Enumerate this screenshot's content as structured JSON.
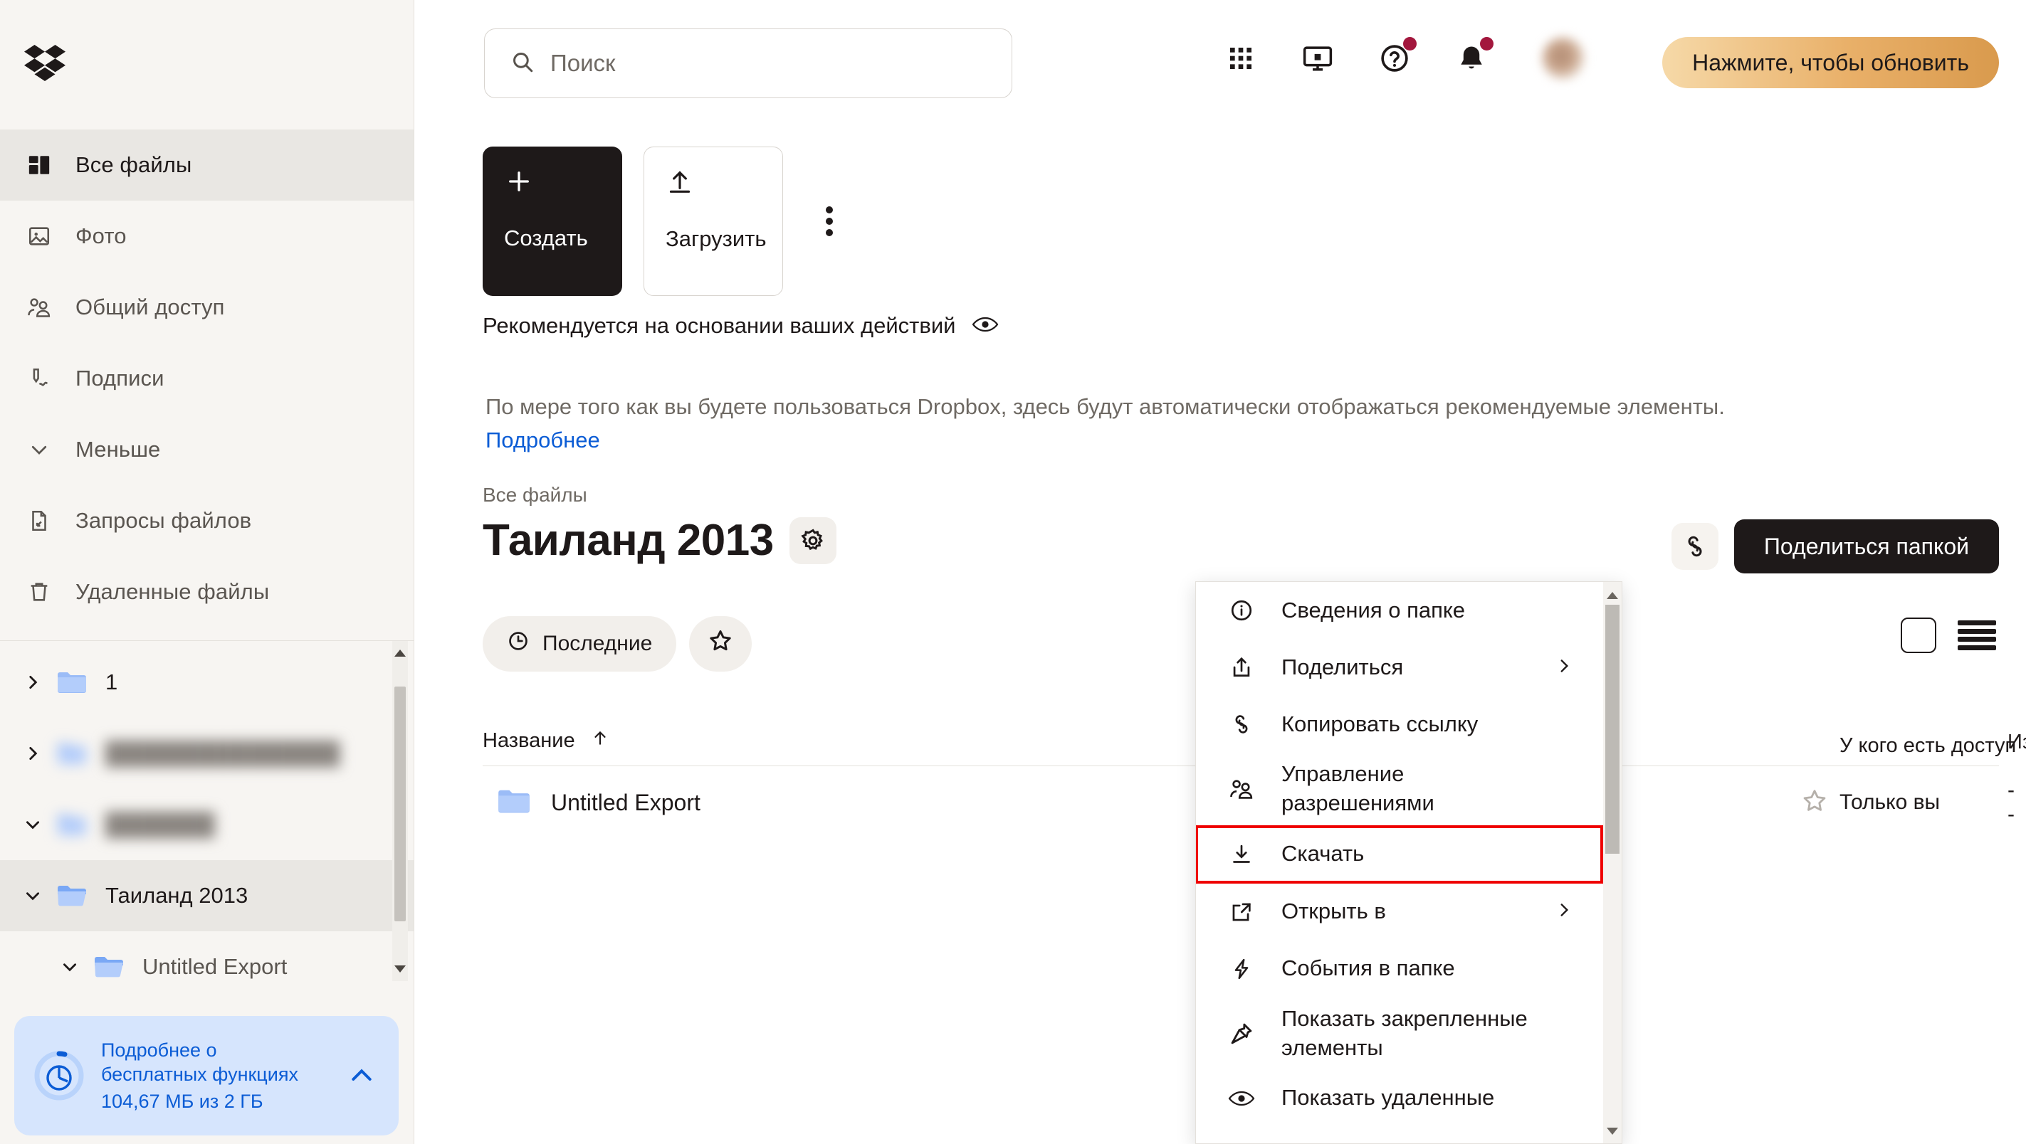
{
  "brand": {
    "name": "Dropbox",
    "logo_icon": "dropbox-logo"
  },
  "sidebar": {
    "nav": [
      {
        "label": "Все файлы",
        "icon": "all-files-icon",
        "active": true
      },
      {
        "label": "Фото",
        "icon": "photo-icon",
        "active": false
      },
      {
        "label": "Общий доступ",
        "icon": "shared-users-icon",
        "active": false
      },
      {
        "label": "Подписи",
        "icon": "signature-icon",
        "active": false
      },
      {
        "label": "Меньше",
        "icon": "chevron-down-icon",
        "active": false
      },
      {
        "label": "Запросы файлов",
        "icon": "file-request-icon",
        "active": false
      },
      {
        "label": "Удаленные файлы",
        "icon": "trash-icon",
        "active": false
      }
    ],
    "tree": [
      {
        "label": "1",
        "expanded": false,
        "blurred": false,
        "level": 1,
        "selected": false
      },
      {
        "label": "",
        "expanded": false,
        "blurred": true,
        "level": 1,
        "selected": false
      },
      {
        "label": "",
        "expanded": true,
        "blurred": true,
        "level": 1,
        "selected": false
      },
      {
        "label": "Таиланд 2013",
        "expanded": true,
        "blurred": false,
        "level": 1,
        "selected": true
      },
      {
        "label": "Untitled Export",
        "expanded": true,
        "blurred": false,
        "level": 2,
        "selected": false
      }
    ],
    "storage": {
      "title": "Подробнее о бесплатных функциях",
      "usage": "104,67 МБ из 2 ГБ",
      "collapse_icon": "chevron-up-icon",
      "ring_icon": "storage-pie-icon",
      "accent": "#0b5cd5",
      "bg": "#d6e5fd"
    }
  },
  "header": {
    "search": {
      "placeholder": "Поиск",
      "icon": "search-icon"
    },
    "icons": [
      {
        "name": "apps-grid-icon",
        "badge": false
      },
      {
        "name": "desktop-icon",
        "badge": false
      },
      {
        "name": "help-icon",
        "badge": true
      },
      {
        "name": "bell-icon",
        "badge": true
      }
    ],
    "avatar": "user-avatar",
    "upgrade_label": "Нажмите, чтобы обновить",
    "badge_color": "#a3173d"
  },
  "actions": {
    "create": {
      "label": "Создать",
      "icon": "plus-icon"
    },
    "upload": {
      "label": "Загрузить",
      "icon": "upload-arrow-icon"
    },
    "more_icon": "kebab-menu-icon"
  },
  "recommended": {
    "heading": "Рекомендуется на основании ваших действий",
    "heading_icon": "eye-icon",
    "body_1": "По мере того как вы будете пользоваться Dropbox, здесь будут автоматически отображаться рекомендуемые",
    "body_2": "элементы.",
    "link": "Подробнее"
  },
  "breadcrumb": "Все файлы",
  "page_title": "Таиланд 2013",
  "gear_icon": "gear-icon",
  "share": {
    "link_icon": "copy-link-icon",
    "button_label": "Поделиться папкой"
  },
  "filters": [
    {
      "label": "Последние",
      "icon": "clock-icon"
    },
    {
      "label": "",
      "icon": "star-icon"
    }
  ],
  "view_controls": {
    "grid_icon": "grid-view-icon",
    "list_icon": "list-view-icon"
  },
  "table": {
    "columns": {
      "name": "Название",
      "sort_icon": "sort-asc-arrow-icon",
      "access": "У кого есть доступ",
      "modified": "Изменено"
    },
    "rows": [
      {
        "name": "Untitled Export",
        "icon": "folder-icon",
        "star_icon": "star-outline-icon",
        "access": "Только вы",
        "modified": "--"
      }
    ]
  },
  "context_menu": {
    "items": [
      {
        "label": "Сведения о папке",
        "icon": "info-icon",
        "submenu": false,
        "highlighted": false
      },
      {
        "label": "Поделиться",
        "icon": "share-icon",
        "submenu": true,
        "highlighted": false
      },
      {
        "label": "Копировать ссылку",
        "icon": "copy-link-icon",
        "submenu": false,
        "highlighted": false
      },
      {
        "label": "Управление разрешениями",
        "icon": "manage-permissions-icon",
        "submenu": false,
        "highlighted": false
      },
      {
        "label": "Скачать",
        "icon": "download-icon",
        "submenu": false,
        "highlighted": true
      },
      {
        "label": "Открыть в",
        "icon": "open-external-icon",
        "submenu": true,
        "highlighted": false
      },
      {
        "label": "События в папке",
        "icon": "lightning-icon",
        "submenu": false,
        "highlighted": false
      },
      {
        "label": "Показать закрепленные элементы",
        "icon": "pin-icon",
        "submenu": false,
        "highlighted": false
      },
      {
        "label": "Показать удаленные",
        "icon": "eye-icon",
        "submenu": false,
        "highlighted": false
      }
    ],
    "highlight_color": "#ef0000",
    "scrollbar_icon": "scrollbar"
  }
}
